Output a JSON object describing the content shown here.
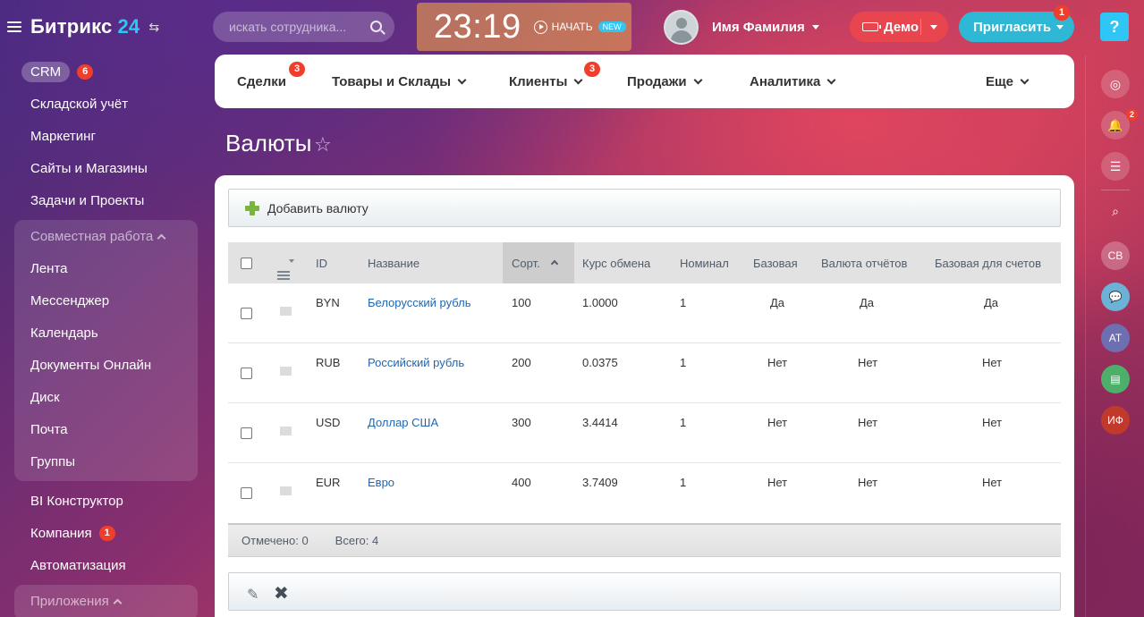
{
  "brand": {
    "name": "Битрикс",
    "number": "24"
  },
  "search": {
    "placeholder": "искать сотрудника..."
  },
  "clock": {
    "time": "23:19",
    "start_label": "НАЧАТЬ",
    "new_badge": "NEW"
  },
  "user": {
    "name": "Имя Фамилия"
  },
  "demo": {
    "label": "Демо"
  },
  "invite": {
    "label": "Пригласить",
    "badge": "1"
  },
  "help": {
    "label": "?"
  },
  "sidebar": {
    "crm_label": "CRM",
    "crm_counter": "6",
    "items_top": [
      "Складской учёт",
      "Маркетинг",
      "Сайты и Магазины",
      "Задачи и Проекты"
    ],
    "group1_title": "Совместная работа",
    "group1_items": [
      "Лента",
      "Мессенджер",
      "Календарь",
      "Документы Онлайн",
      "Диск",
      "Почта",
      "Группы"
    ],
    "items_mid": [
      "BI Конструктор",
      "Компания",
      "Автоматизация"
    ],
    "company_counter": "1",
    "group2_title": "Приложения"
  },
  "topnav": {
    "items": [
      {
        "label": "Сделки",
        "badge": "3"
      },
      {
        "label": "Товары и Склады"
      },
      {
        "label": "Клиенты",
        "badge": "3"
      },
      {
        "label": "Продажи"
      },
      {
        "label": "Аналитика"
      },
      {
        "label": "Еще"
      }
    ]
  },
  "page": {
    "title": "Валюты"
  },
  "toolbar": {
    "add_label": "Добавить валюту"
  },
  "grid": {
    "columns": [
      "ID",
      "Название",
      "Сорт.",
      "Курс обмена",
      "Номинал",
      "Базовая",
      "Валюта отчётов",
      "Базовая для счетов"
    ],
    "rows": [
      {
        "id": "BYN",
        "name": "Белорусский рубль",
        "sort": "100",
        "rate": "1.0000",
        "nominal": "1",
        "base": "Да",
        "report": "Да",
        "invoice": "Да"
      },
      {
        "id": "RUB",
        "name": "Российский рубль",
        "sort": "200",
        "rate": "0.0375",
        "nominal": "1",
        "base": "Нет",
        "report": "Нет",
        "invoice": "Нет"
      },
      {
        "id": "USD",
        "name": "Доллар США",
        "sort": "300",
        "rate": "3.4414",
        "nominal": "1",
        "base": "Нет",
        "report": "Нет",
        "invoice": "Нет"
      },
      {
        "id": "EUR",
        "name": "Евро",
        "sort": "400",
        "rate": "3.7409",
        "nominal": "1",
        "base": "Нет",
        "report": "Нет",
        "invoice": "Нет"
      }
    ],
    "footer": {
      "selected": "Отмечено: 0",
      "total": "Всего: 4"
    }
  },
  "rail": {
    "avatars": [
      "СВ",
      "АТ",
      "ИФ"
    ],
    "bell_badge": "2"
  },
  "colors": {
    "accent": "#2fc6f6",
    "counter": "#ef3e2c",
    "link": "#2067b0",
    "demo": "#e8454f",
    "invite": "#2fb8d6"
  }
}
